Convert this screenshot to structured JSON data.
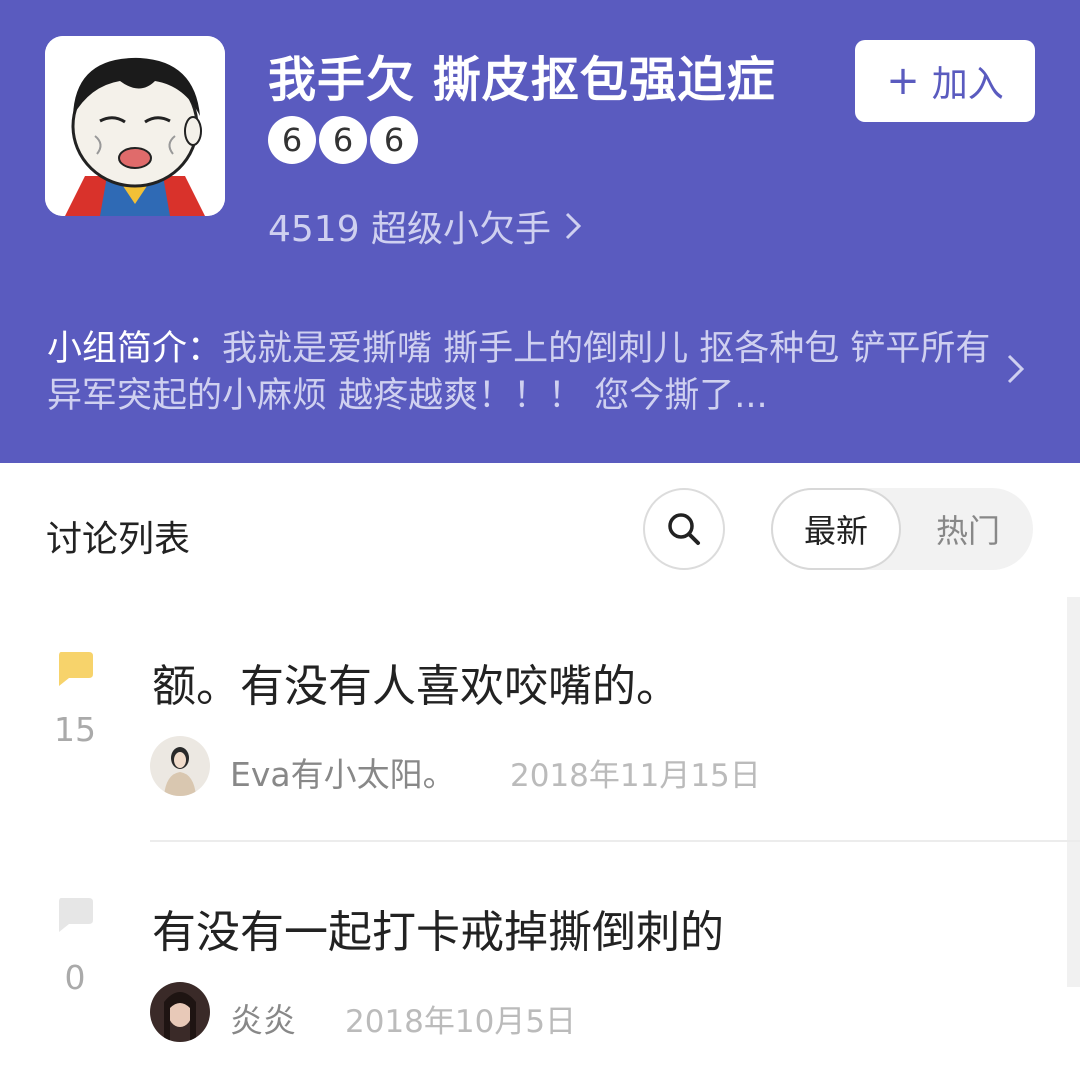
{
  "group": {
    "title": "我手欠 撕皮抠包强迫症",
    "badges": [
      "6",
      "6",
      "6"
    ],
    "members_text": "4519 超级小欠手",
    "join_label": "加入",
    "join_plus": "+",
    "intro_label": "小组简介：",
    "intro_text": "我就是爱撕嘴 撕手上的倒刺儿 抠各种包  铲平所有异军突起的小麻烦 越疼越爽！！！  您今撕了..."
  },
  "list": {
    "section_title": "讨论列表",
    "sort_options": [
      "最新",
      "热门"
    ],
    "active_sort": "最新"
  },
  "posts": [
    {
      "title": "额。有没有人喜欢咬嘴的。",
      "count": "15",
      "author": "Eva有小太阳。",
      "date": "2018年11月15日",
      "icon_color": "#f7d36b"
    },
    {
      "title": "有没有一起打卡戒掉撕倒刺的",
      "count": "0",
      "author": "炎炎",
      "date": "2018年10月5日",
      "icon_color": "#e6e6e6"
    }
  ],
  "colors": {
    "header_bg": "#5a5bbf",
    "accent": "#5a5bbf"
  }
}
